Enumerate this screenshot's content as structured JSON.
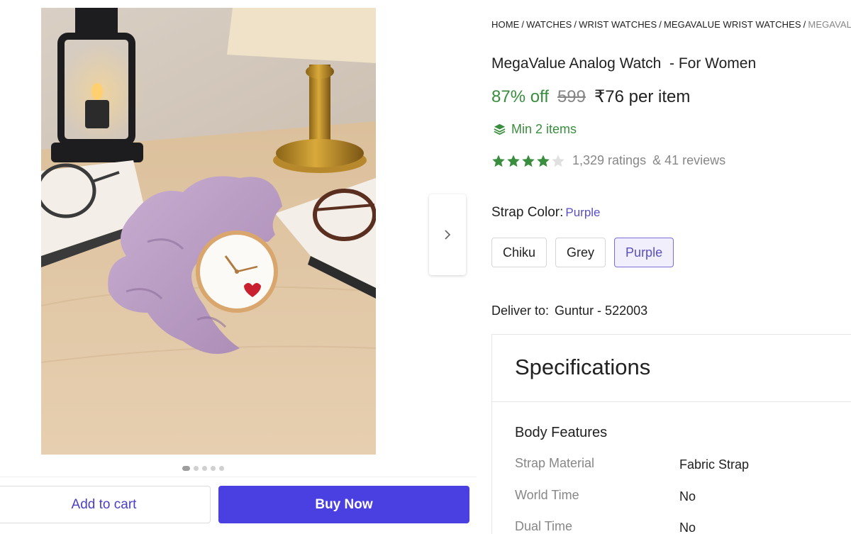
{
  "breadcrumb": [
    "HOME",
    "WATCHES",
    "WRIST WATCHES",
    "MEGAVALUE WRIST WATCHES",
    "MEGAVALUE"
  ],
  "product": {
    "title": "MegaValue Analog Watch  - For Women",
    "discount": "87% off",
    "mrp": "599",
    "price": "₹76 per item",
    "min_items": "Min 2 items",
    "rating_stars": 4,
    "ratings": "1,329 ratings",
    "reviews": "& 41 reviews"
  },
  "strap": {
    "label": "Strap Color:",
    "selected": "Purple",
    "options": [
      "Chiku",
      "Grey",
      "Purple"
    ]
  },
  "delivery": {
    "label": "Deliver to:",
    "location": "Guntur - 522003"
  },
  "specs": {
    "title": "Specifications",
    "section": "Body Features",
    "rows": [
      {
        "key": "Strap Material",
        "value": "Fabric Strap"
      },
      {
        "key": "World Time",
        "value": "No"
      },
      {
        "key": "Dual Time",
        "value": "No"
      }
    ]
  },
  "gallery": {
    "total_images": 5,
    "active_index": 0
  },
  "actions": {
    "add_to_cart": "Add to cart",
    "buy_now": "Buy Now"
  },
  "colors": {
    "accent": "#4a3fe0",
    "green": "#388e3c",
    "muted": "#878787",
    "star": "#388e3c"
  },
  "icons": {
    "next": "chevron-right-icon",
    "min_items": "stack-layers-icon",
    "star": "star-icon"
  }
}
